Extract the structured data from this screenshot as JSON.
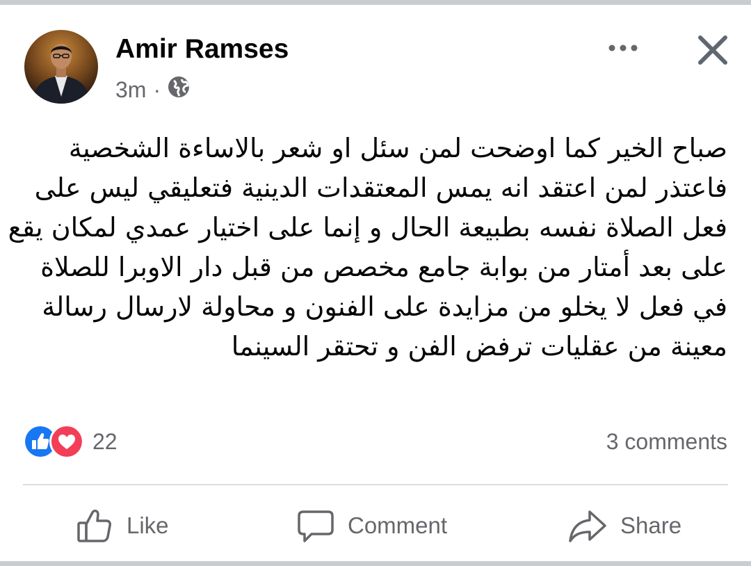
{
  "post": {
    "author": "Amir Ramses",
    "time": "3m",
    "separator": "·",
    "privacy_icon": "globe-icon",
    "text_lines": [
      "صباح الخير كما اوضحت لمن سئل او شعر بالاساءة الشخصية",
      "فاعتذر لمن اعتقد انه يمس المعتقدات الدينية فتعليقي ليس على",
      "فعل الصلاة نفسه بطبيعة الحال و إنما على اختيار عمدي لمكان يقع",
      "على بعد أمتار من بوابة جامع مخصص من قبل دار الاوبرا للصلاة",
      "في فعل لا يخلو من مزايدة على الفنون و محاولة لارسال رسالة",
      "معينة من عقليات ترفض الفن و تحتقر السينما"
    ]
  },
  "reactions": {
    "count": "22",
    "types": [
      "like-icon",
      "love-icon"
    ],
    "like_color": "#1877f2",
    "love_color": "#f33e58"
  },
  "comments": {
    "label": "3 comments"
  },
  "actions": {
    "like": "Like",
    "comment": "Comment",
    "share": "Share"
  },
  "colors": {
    "text_primary": "#050505",
    "text_secondary": "#65676b",
    "divider": "#dadde1"
  }
}
